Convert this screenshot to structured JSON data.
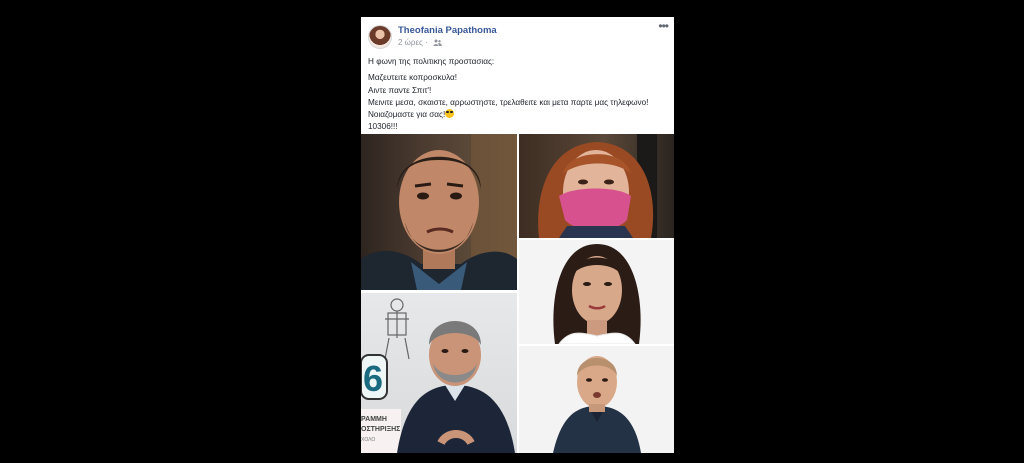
{
  "post": {
    "author": "Theofania Papathoma",
    "time": "2 ώρες",
    "separator": "·",
    "more_label": "•••",
    "lines": [
      "Η φωνη της πολιτικης προστασιας:",
      "Μαζευτειτε κοπροσκυλα!",
      "Αιντε παντε Σπιτ'!",
      "Μεινιτε μεσα, σκαιστε, αρρωστηστε, τρελαθειτε και μετα παρτε μας τηλεφωνο!",
      "Νοιαζομαστε για σας!",
      "10306!!!"
    ],
    "emoji": "smiling-face-with-sunglasses",
    "images": {
      "tile4_number": "6",
      "tile4_sign_line1": "ΡΑΜΜΗ",
      "tile4_sign_line2": "ΟΣΤΗΡΙΞΗΣ",
      "tile4_sign_line3": "ΧΟΛΟ"
    }
  },
  "colors": {
    "page_bg": "#000000",
    "card_bg": "#ffffff",
    "author_blue": "#385898",
    "meta_gray": "#90949c",
    "mask_pink": "#d6518e"
  }
}
